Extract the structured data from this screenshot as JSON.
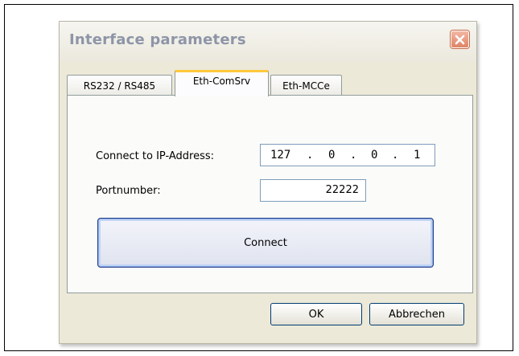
{
  "dialog": {
    "title": "Interface parameters",
    "close_icon": "close-x-icon"
  },
  "tabs": [
    {
      "label": "RS232 / RS485",
      "active": false
    },
    {
      "label": "Eth-ComSrv",
      "active": true
    },
    {
      "label": "Eth-MCCe",
      "active": false
    }
  ],
  "form": {
    "ip_label": "Connect to IP-Address:",
    "ip_octets": [
      "127",
      "0",
      "0",
      "1"
    ],
    "ip_separator": ".",
    "port_label": "Portnumber:",
    "port_value": "22222",
    "connect_label": "Connect"
  },
  "buttons": {
    "ok_label": "OK",
    "cancel_label": "Abbrechen"
  },
  "colors": {
    "dialog_bg": "#ECE9D8",
    "active_tab_highlight": "#FFC83C",
    "close_button": "#DF8364",
    "title_text": "#8E95A8"
  }
}
